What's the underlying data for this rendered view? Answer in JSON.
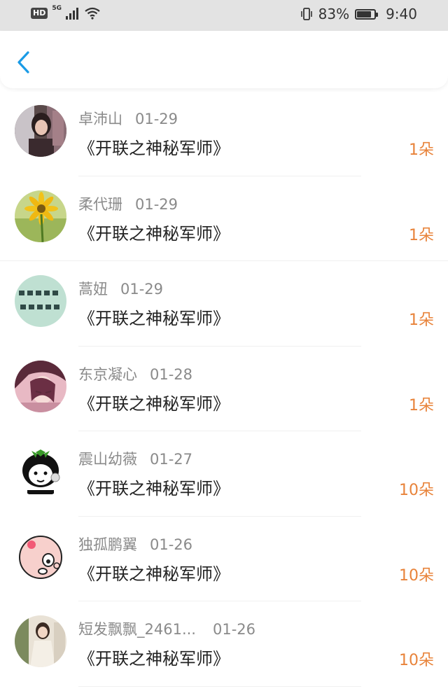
{
  "status_bar": {
    "hd": "HD",
    "network": "5G",
    "battery_percent": "83%",
    "battery_level": 0.83,
    "time": "9:40"
  },
  "header": {
    "back_icon": "chevron-left-icon",
    "accent_color": "#1a9be6"
  },
  "items": [
    {
      "name": "卓沛山",
      "date": "01-29",
      "title": "《开联之神秘军师》",
      "count": "1朵",
      "avatar": "photo-girl"
    },
    {
      "name": "柔代珊",
      "date": "01-29",
      "title": "《开联之神秘军师》",
      "count": "1朵",
      "avatar": "sunflower"
    },
    {
      "name": "蒿妞",
      "date": "01-29",
      "title": "《开联之神秘军师》",
      "count": "1朵",
      "avatar": "calligraphy"
    },
    {
      "name": "东京凝心",
      "date": "01-28",
      "title": "《开联之神秘军师》",
      "count": "1朵",
      "avatar": "anime"
    },
    {
      "name": "震山幼薇",
      "date": "01-27",
      "title": "《开联之神秘军师》",
      "count": "10朵",
      "avatar": "cartoon-face"
    },
    {
      "name": "独孤鹏翼",
      "date": "01-26",
      "title": "《开联之神秘军师》",
      "count": "10朵",
      "avatar": "cartoon-pig"
    },
    {
      "name": "短发飘飘_2461...",
      "date": "01-26",
      "title": "《开联之神秘军师》",
      "count": "10朵",
      "avatar": "photo-woman"
    }
  ],
  "colors": {
    "count": "#e8833a",
    "name": "#8a8a8a",
    "title": "#222222"
  }
}
